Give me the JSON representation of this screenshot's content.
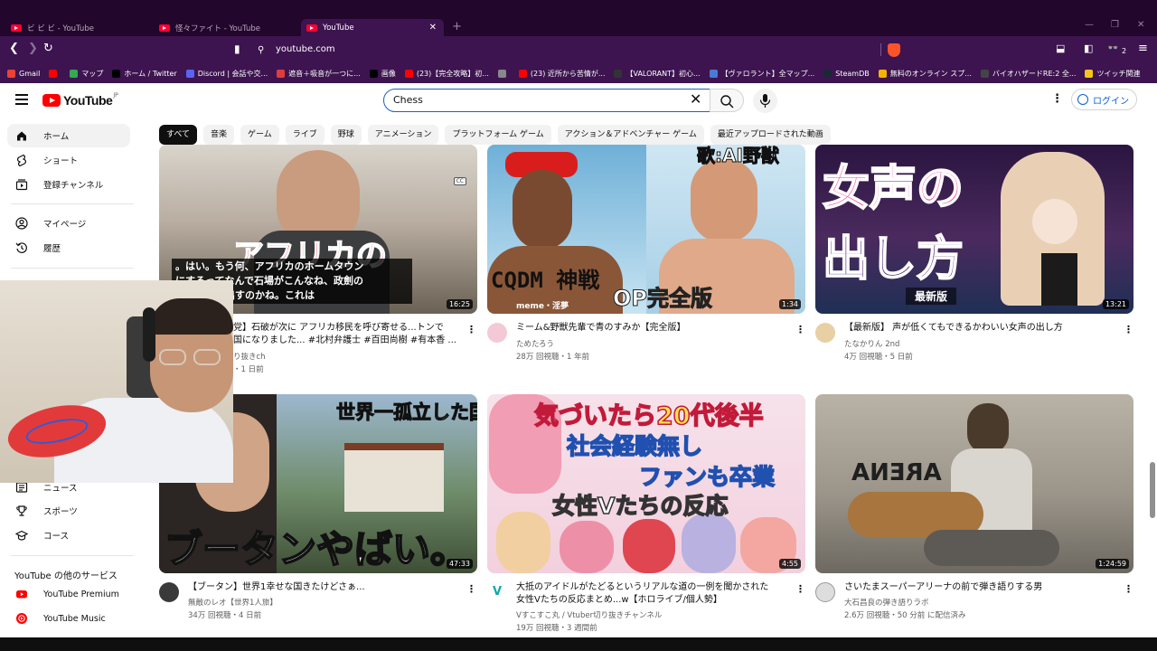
{
  "browser": {
    "tabs": [
      {
        "label": "ビ ビ ビ - YouTube",
        "active": false
      },
      {
        "label": "怪々ファイト - YouTube",
        "active": false
      },
      {
        "label": "YouTube",
        "active": true
      }
    ],
    "url": "youtube.com",
    "ext_badge": "2",
    "bookmarks": [
      {
        "label": "Gmail",
        "color": "#ea4335"
      },
      {
        "label": "",
        "color": "#ff0000"
      },
      {
        "label": "マップ",
        "color": "#34a853"
      },
      {
        "label": "ホーム / Twitter",
        "color": "#000000"
      },
      {
        "label": "Discord | 会話や交...",
        "color": "#5865f2"
      },
      {
        "label": "遮音＋吸音が一つに...",
        "color": "#e03c3c"
      },
      {
        "label": "画像",
        "color": "#000000"
      },
      {
        "label": "(23)【完全攻略】初...",
        "color": "#ff0000"
      },
      {
        "label": "",
        "color": "#888888"
      },
      {
        "label": "(23) 近所から苦情が...",
        "color": "#ff0000"
      },
      {
        "label": "【VALORANT】初心...",
        "color": "#333333"
      },
      {
        "label": "【ヴァロラント】全マップ...",
        "color": "#4a7bd1"
      },
      {
        "label": "SteamDB",
        "color": "#1b2838"
      },
      {
        "label": "無料のオンライン スプ...",
        "color": "#f4b400"
      },
      {
        "label": "バイオハザードRE:2 全...",
        "color": "#444444"
      },
      {
        "label": "ツイッチ関連",
        "color": "#f5c518"
      }
    ]
  },
  "youtube": {
    "logo_text": "YouTube",
    "region": "JP",
    "search_value": "Chess",
    "login_label": "ログイン",
    "chips": [
      "すべて",
      "音楽",
      "ゲーム",
      "ライブ",
      "野球",
      "アニメーション",
      "プラットフォーム ゲーム",
      "アクション＆アドベンチャー ゲーム",
      "最近アップロードされた動画"
    ],
    "sidebar": {
      "top": [
        {
          "label": "ホーム",
          "icon": "home-icon"
        },
        {
          "label": "ショート",
          "icon": "shorts-icon"
        },
        {
          "label": "登録チャンネル",
          "icon": "subscriptions-icon"
        }
      ],
      "you": [
        {
          "label": "マイページ",
          "icon": "user-icon"
        },
        {
          "label": "履歴",
          "icon": "history-icon"
        }
      ],
      "explore": [
        {
          "label": "ニュース",
          "icon": "news-icon"
        },
        {
          "label": "スポーツ",
          "icon": "trophy-icon"
        },
        {
          "label": "コース",
          "icon": "course-icon"
        }
      ],
      "more_heading": "YouTube の他のサービス",
      "more": [
        {
          "label": "YouTube Premium",
          "icon": "youtube-premium-icon"
        },
        {
          "label": "YouTube Music",
          "icon": "youtube-music-icon"
        }
      ]
    },
    "videos": [
      {
        "title": "党】石破が次に アフリカ移民を呼び寄せる...トンで\n国になりました... #北村弁護士 #百田尚樹 #有本香 ...",
        "channel": "り抜きch",
        "meta": "・1 日前",
        "duration": "16:25",
        "overlay": "アフリカの",
        "caption": "。はい。もう何、アフリカのホームタウン\nにするってなんで石場がこんなね、政劍の\nなことやり出すのかね。これは"
      },
      {
        "title": "ミーム&野獣先輩で青のすみか【完全版】",
        "channel": "ためたろう",
        "meta": "28万 回視聴・1 年前",
        "duration": "1:34",
        "overlay": "CQDM 神戦",
        "overlay2": "OP完全版",
        "overlay3": "meme・淫夢",
        "overlay4": "歌:AI野獣"
      },
      {
        "title": "【最新版】 声が低くてもできるかわいい女声の出し方",
        "channel": "たなかりん 2nd",
        "meta": "4万 回視聴・5 日前",
        "duration": "13:21",
        "overlay": "女声の",
        "overlay2": "出し方",
        "overlay3": "最新版"
      },
      {
        "title": "【ブータン】世界1幸せな国きたけどさぁ...",
        "channel": "無敵のレオ【世界1人旅】",
        "meta": "34万 回視聴・4 日前",
        "duration": "47:33",
        "overlay": "世界一孤立した国",
        "overlay2": "ブータンやばい。"
      },
      {
        "title": "大抵のアイドルがたどるというリアルな道の一例を聞かされた\n女性Vたちの反応まとめ...w【ホロライブ/個人勢】",
        "channel": "Vすこすこ丸 / Vtuber切り抜きチャンネル",
        "meta": "19万 回視聴・3 週間前",
        "duration": "4:55",
        "overlay": "気づいたら20代後半",
        "overlay2": "社会経験無し",
        "overlay3": "ファンも卒業",
        "overlay4": "女性Vたちの反応"
      },
      {
        "title": "さいたまスーパーアリーナの前で弾き語りする男",
        "channel": "大石昌良の弾き語りラボ",
        "meta": "2.6万 回視聴・50 分前 に配信済み",
        "duration": "1:24:59",
        "overlay": "ARENA"
      }
    ]
  }
}
